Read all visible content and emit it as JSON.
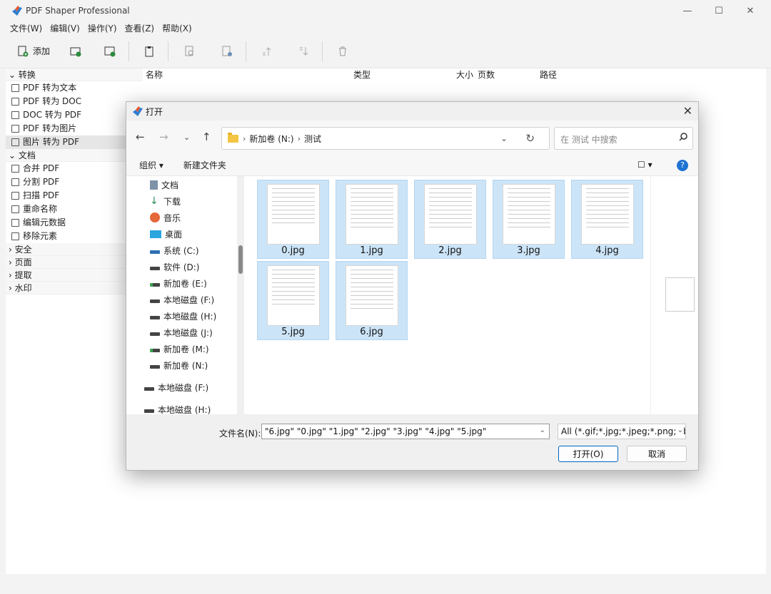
{
  "app": {
    "title": "PDF Shaper Professional",
    "window_controls": [
      "—",
      "☐",
      "✕"
    ]
  },
  "menu": [
    "文件(W)",
    "编辑(V)",
    "操作(Y)",
    "查看(Z)",
    "帮助(X)"
  ],
  "toolbar": {
    "add_label": "添加",
    "buttons": [
      "add-folder",
      "add-file",
      "paste",
      "preview",
      "info",
      "move-up",
      "move-down",
      "delete"
    ]
  },
  "sidebar": {
    "sections": [
      {
        "label": "转换",
        "expanded": true,
        "items": [
          "PDF 转为文本",
          "PDF 转为 DOC",
          "DOC 转为 PDF",
          "PDF 转为图片",
          "图片 转为 PDF"
        ]
      },
      {
        "label": "文档",
        "expanded": true,
        "items": [
          "合并 PDF",
          "分割 PDF",
          "扫描 PDF",
          "重命名称",
          "编辑元数据",
          "移除元素"
        ]
      },
      {
        "label": "安全",
        "expanded": false,
        "items": []
      },
      {
        "label": "页面",
        "expanded": false,
        "items": []
      },
      {
        "label": "提取",
        "expanded": false,
        "items": []
      },
      {
        "label": "水印",
        "expanded": false,
        "items": []
      }
    ],
    "selected": "图片 转为 PDF"
  },
  "list_columns": [
    "名称",
    "类型",
    "大小",
    "页数",
    "路径"
  ],
  "dialog": {
    "title": "打开",
    "breadcrumb": [
      "新加卷 (N:)",
      "测试"
    ],
    "search_placeholder": "在 测试 中搜索",
    "organize_label": "组织 ▾",
    "new_folder_label": "新建文件夹",
    "help_label": "?",
    "tree": [
      "文档",
      "下载",
      "音乐",
      "桌面",
      "系统 (C:)",
      "软件 (D:)",
      "新加卷 (E:)",
      "本地磁盘 (F:)",
      "本地磁盘 (H:)",
      "本地磁盘 (J:)",
      "新加卷 (M:)",
      "新加卷 (N:)",
      "本地磁盘 (F:)",
      "本地磁盘 (H:)"
    ],
    "files": [
      "0.jpg",
      "1.jpg",
      "2.jpg",
      "3.jpg",
      "4.jpg",
      "5.jpg",
      "6.jpg"
    ],
    "filename_label": "文件名(N):",
    "filename_value": "\"6.jpg\" \"0.jpg\" \"1.jpg\" \"2.jpg\" \"3.jpg\" \"4.jpg\" \"5.jpg\"",
    "filetype_value": "All (*.gif;*.jpg;*.jpeg;*.png;*.b",
    "open_label": "打开(O)",
    "cancel_label": "取消"
  },
  "colors": {
    "selection": "#cce4f7",
    "accent": "#0067c0"
  }
}
